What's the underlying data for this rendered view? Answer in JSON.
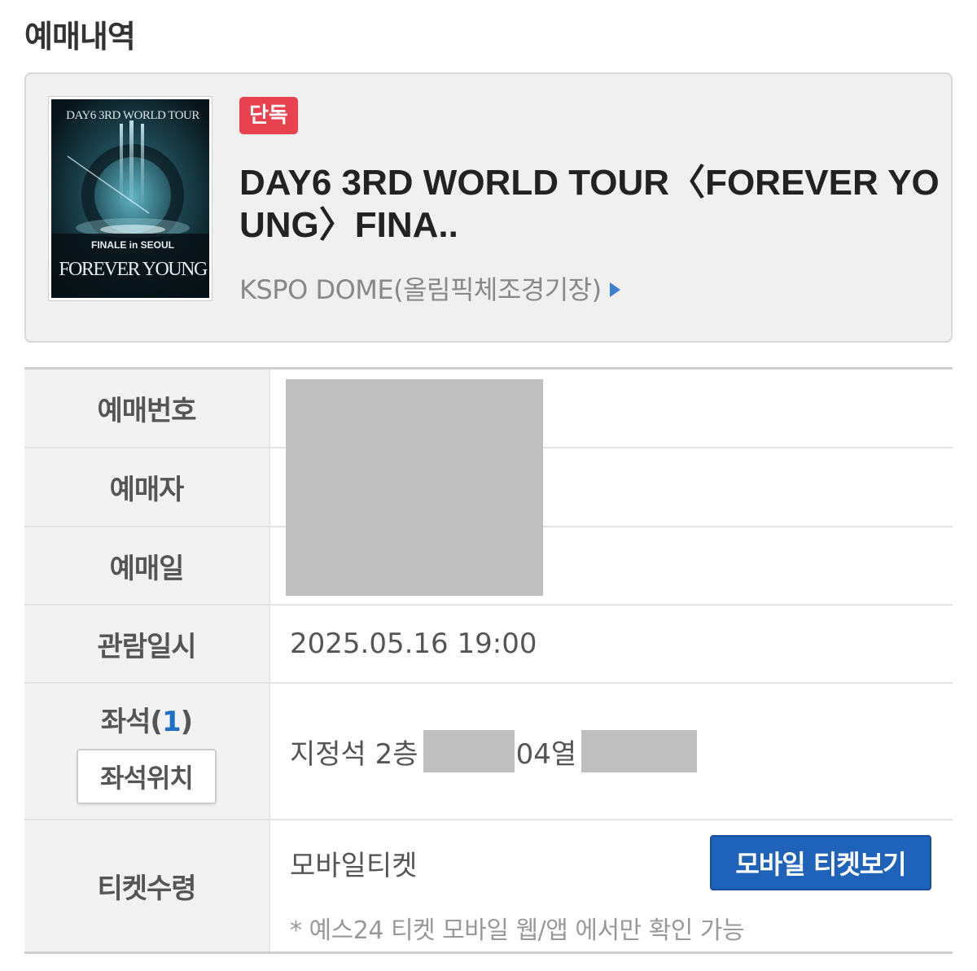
{
  "page": {
    "title": "예매내역"
  },
  "event": {
    "badge": "단독",
    "title": "DAY6 3RD WORLD TOUR〈FOREVER YOUNG〉FINA..",
    "venue": "KSPO DOME(올림픽체조경기장)",
    "poster": {
      "header_text": "DAY6 3RD WORLD TOUR",
      "subtitle_text": "FINALE in SEOUL",
      "main_text": "FOREVER YOUNG"
    }
  },
  "booking": {
    "booking_number_label": "예매번호",
    "booker_label": "예매자",
    "booking_date_label": "예매일",
    "viewing_datetime_label": "관람일시",
    "viewing_datetime": "2025.05.16 19:00",
    "seats_label": "좌석",
    "seats_count_open": "(",
    "seats_count": "1",
    "seats_count_close": ")",
    "seat_map_button": "좌석위치",
    "seat_prefix": "지정석 2층",
    "seat_row": "04열",
    "ticket_receipt_label": "티켓수령",
    "ticket_type": "모바일티켓",
    "mobile_ticket_button": "모바일 티켓보기",
    "ticket_note": "* 예스24 티켓 모바일 웹/앱 에서만 확인 가능"
  },
  "colors": {
    "badge": "#e8424f",
    "primary_button": "#1f62b9",
    "count_accent": "#1f6fc7",
    "redaction": "#bfbfbf"
  }
}
